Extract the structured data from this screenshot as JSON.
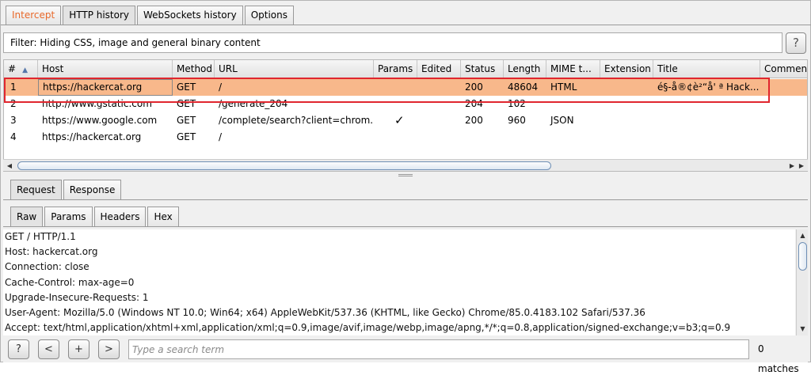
{
  "top_tabs": [
    {
      "label": "Intercept"
    },
    {
      "label": "HTTP history"
    },
    {
      "label": "WebSockets history"
    },
    {
      "label": "Options"
    }
  ],
  "filter": {
    "text": "Filter: Hiding CSS, image and general binary content",
    "help_label": "?"
  },
  "table": {
    "columns": [
      "#",
      "Host",
      "Method",
      "URL",
      "Params",
      "Edited",
      "Status",
      "Length",
      "MIME t...",
      "Extension",
      "Title",
      "Comment"
    ],
    "sort_indicator": "▲",
    "rows": [
      {
        "num": "1",
        "host": "https://hackercat.org",
        "method": "GET",
        "url": "/",
        "params": "",
        "edited": "",
        "status": "200",
        "length": "48604",
        "mime": "HTML",
        "extension": "",
        "title": "é§-å®¢è²“å' ª Hack...",
        "comment": ""
      },
      {
        "num": "2",
        "host": "http://www.gstatic.com",
        "method": "GET",
        "url": "/generate_204",
        "params": "",
        "edited": "",
        "status": "204",
        "length": "102",
        "mime": "",
        "extension": "",
        "title": "",
        "comment": ""
      },
      {
        "num": "3",
        "host": "https://www.google.com",
        "method": "GET",
        "url": "/complete/search?client=chrom...",
        "params": "✓",
        "edited": "",
        "status": "200",
        "length": "960",
        "mime": "JSON",
        "extension": "",
        "title": "",
        "comment": ""
      },
      {
        "num": "4",
        "host": "https://hackercat.org",
        "method": "GET",
        "url": "/",
        "params": "",
        "edited": "",
        "status": "",
        "length": "",
        "mime": "",
        "extension": "",
        "title": "",
        "comment": ""
      }
    ],
    "selected_row": 0
  },
  "message_tabs": [
    {
      "label": "Request"
    },
    {
      "label": "Response"
    }
  ],
  "view_tabs": [
    {
      "label": "Raw"
    },
    {
      "label": "Params"
    },
    {
      "label": "Headers"
    },
    {
      "label": "Hex"
    }
  ],
  "raw_lines": [
    "GET / HTTP/1.1",
    "Host: hackercat.org",
    "Connection: close",
    "Cache-Control: max-age=0",
    "Upgrade-Insecure-Requests: 1",
    "User-Agent: Mozilla/5.0 (Windows NT 10.0; Win64; x64) AppleWebKit/537.36 (KHTML, like Gecko) Chrome/85.0.4183.102 Safari/537.36",
    "Accept: text/html,application/xhtml+xml,application/xml;q=0.9,image/avif,image/webp,image/apng,*/*;q=0.8,application/signed-exchange;v=b3;q=0.9"
  ],
  "bottom": {
    "help_label": "?",
    "prev_label": "<",
    "add_label": "+",
    "next_label": ">",
    "search_placeholder": "Type a search term",
    "matches": "0 matches"
  },
  "colors": {
    "selected_row": "#f8b88b",
    "highlight_border": "#e0262e",
    "intercept_text": "#e8692b"
  }
}
